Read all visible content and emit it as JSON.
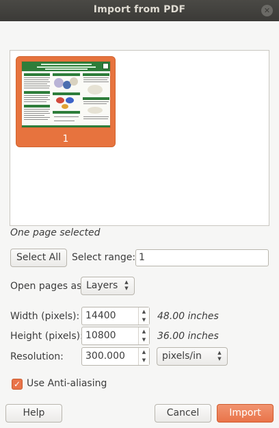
{
  "window": {
    "title": "Import from PDF"
  },
  "icons": {
    "close": "✕",
    "spin_up": "▲",
    "spin_down": "▼",
    "combo_up": "▲",
    "combo_down": "▼",
    "check": "✓"
  },
  "preview": {
    "pages": [
      {
        "label": "1",
        "selected": true
      }
    ],
    "status": "One page selected"
  },
  "selection": {
    "select_all_label": "Select All",
    "range_label": "Select range:",
    "range_value": "1"
  },
  "open_as": {
    "label": "Open pages as",
    "value": "Layers"
  },
  "width": {
    "label": "Width (pixels):",
    "value": "14400",
    "note": "48.00 inches"
  },
  "height": {
    "label": "Height (pixels):",
    "value": "10800",
    "note": "36.00 inches"
  },
  "resolution": {
    "label": "Resolution:",
    "value": "300.000",
    "unit": "pixels/in"
  },
  "antialias": {
    "label": "Use Anti-aliasing",
    "checked": true
  },
  "footer": {
    "help_label": "Help",
    "cancel_label": "Cancel",
    "import_label": "Import"
  },
  "colors": {
    "accent": "#e9744a",
    "titlebar": "#3b3a37",
    "poster_band": "#2e7d3a"
  }
}
